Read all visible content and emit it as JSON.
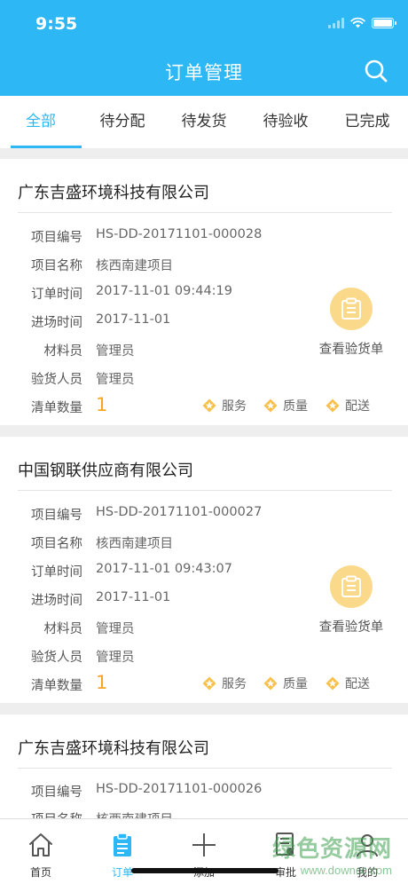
{
  "status_bar": {
    "time": "9:55"
  },
  "header": {
    "title": "订单管理",
    "search_icon": "search-icon"
  },
  "tabs": [
    {
      "label": "全部",
      "active": true
    },
    {
      "label": "待分配",
      "active": false
    },
    {
      "label": "待发货",
      "active": false
    },
    {
      "label": "待验收",
      "active": false
    },
    {
      "label": "已完成",
      "active": false
    }
  ],
  "labels": {
    "project_no": "项目编号",
    "project_name": "项目名称",
    "order_time": "订单时间",
    "entry_time": "进场时间",
    "material_staff": "材料员",
    "inspector": "验货人员",
    "quantity": "清单数量",
    "service": "服务",
    "quality": "质量",
    "delivery": "配送",
    "view_receipt": "查看验货单"
  },
  "orders": [
    {
      "company": "广东吉盛环境科技有限公司",
      "project_no": "HS-DD-20171101-000028",
      "project_name": "核西南建项目",
      "order_time": "2017-11-01 09:44:19",
      "entry_time": "2017-11-01",
      "material_staff": "管理员",
      "inspector": "管理员",
      "quantity": "1"
    },
    {
      "company": "中国钢联供应商有限公司",
      "project_no": "HS-DD-20171101-000027",
      "project_name": "核西南建项目",
      "order_time": "2017-11-01 09:43:07",
      "entry_time": "2017-11-01",
      "material_staff": "管理员",
      "inspector": "管理员",
      "quantity": "1"
    },
    {
      "company": "广东吉盛环境科技有限公司",
      "project_no": "HS-DD-20171101-000026",
      "project_name": "核西南建项目"
    }
  ],
  "tabbar": [
    {
      "label": "首页",
      "icon": "home-icon",
      "active": false
    },
    {
      "label": "订单",
      "icon": "clipboard-icon",
      "active": true
    },
    {
      "label": "添加",
      "icon": "plus-icon",
      "active": false
    },
    {
      "label": "审批",
      "icon": "approval-icon",
      "active": false
    },
    {
      "label": "我的",
      "icon": "user-icon",
      "active": false
    }
  ],
  "watermark": {
    "text": "绿色资源网",
    "url": "www.downcc.com"
  },
  "colors": {
    "primary": "#2db7f5",
    "accent": "#f5a623",
    "badge": "#fbd98a"
  }
}
